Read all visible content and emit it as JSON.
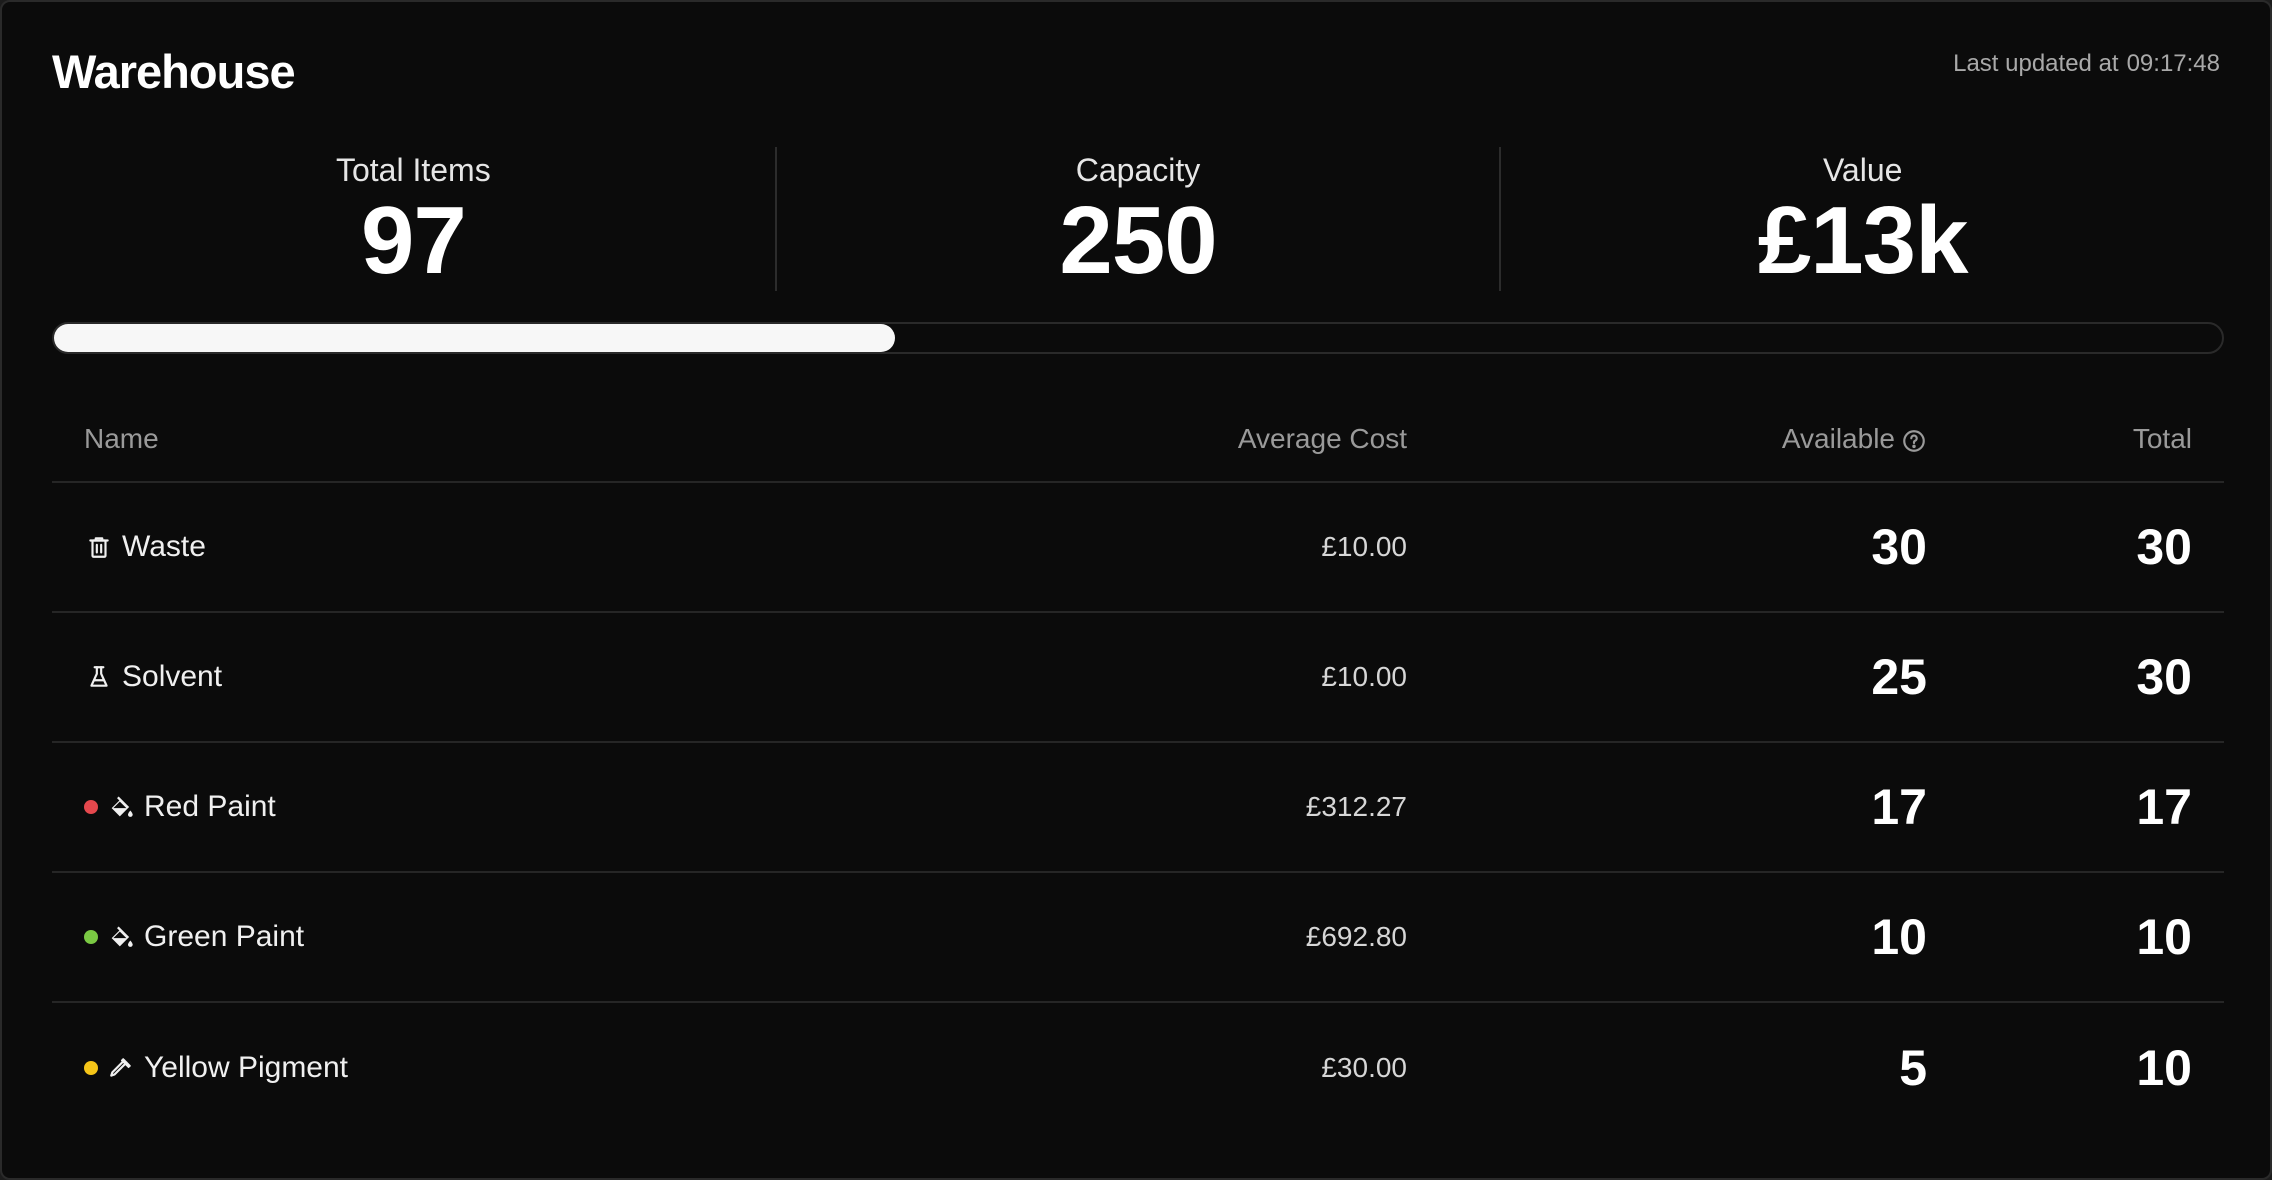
{
  "header": {
    "title": "Warehouse",
    "updated_label": "Last updated at",
    "updated_time": "09:17:48"
  },
  "stats": [
    {
      "label": "Total Items",
      "value": "97"
    },
    {
      "label": "Capacity",
      "value": "250"
    },
    {
      "label": "Value",
      "value": "£13k"
    }
  ],
  "capacity_progress": {
    "used": 97,
    "capacity": 250,
    "fraction": 0.388
  },
  "table": {
    "columns": [
      "Name",
      "Average Cost",
      "Available",
      "Total"
    ],
    "rows": [
      {
        "name": "Waste",
        "icon": "trash-icon",
        "dot_color": "",
        "average_cost": "£10.00",
        "available": "30",
        "total": "30"
      },
      {
        "name": "Solvent",
        "icon": "flask-icon",
        "dot_color": "",
        "average_cost": "£10.00",
        "available": "25",
        "total": "30"
      },
      {
        "name": "Red Paint",
        "icon": "paint-bucket-icon",
        "dot_color": "#e5484d",
        "average_cost": "£312.27",
        "available": "17",
        "total": "17"
      },
      {
        "name": "Green Paint",
        "icon": "paint-bucket-icon",
        "dot_color": "#7ac943",
        "average_cost": "£692.80",
        "available": "10",
        "total": "10"
      },
      {
        "name": "Yellow Pigment",
        "icon": "pipette-icon",
        "dot_color": "#f5c518",
        "average_cost": "£30.00",
        "available": "5",
        "total": "10"
      }
    ]
  },
  "colors": {
    "background": "#0b0b0b",
    "text": "#ffffff",
    "muted": "#9a9a9a",
    "progress_fill": "#f7f7f7"
  }
}
